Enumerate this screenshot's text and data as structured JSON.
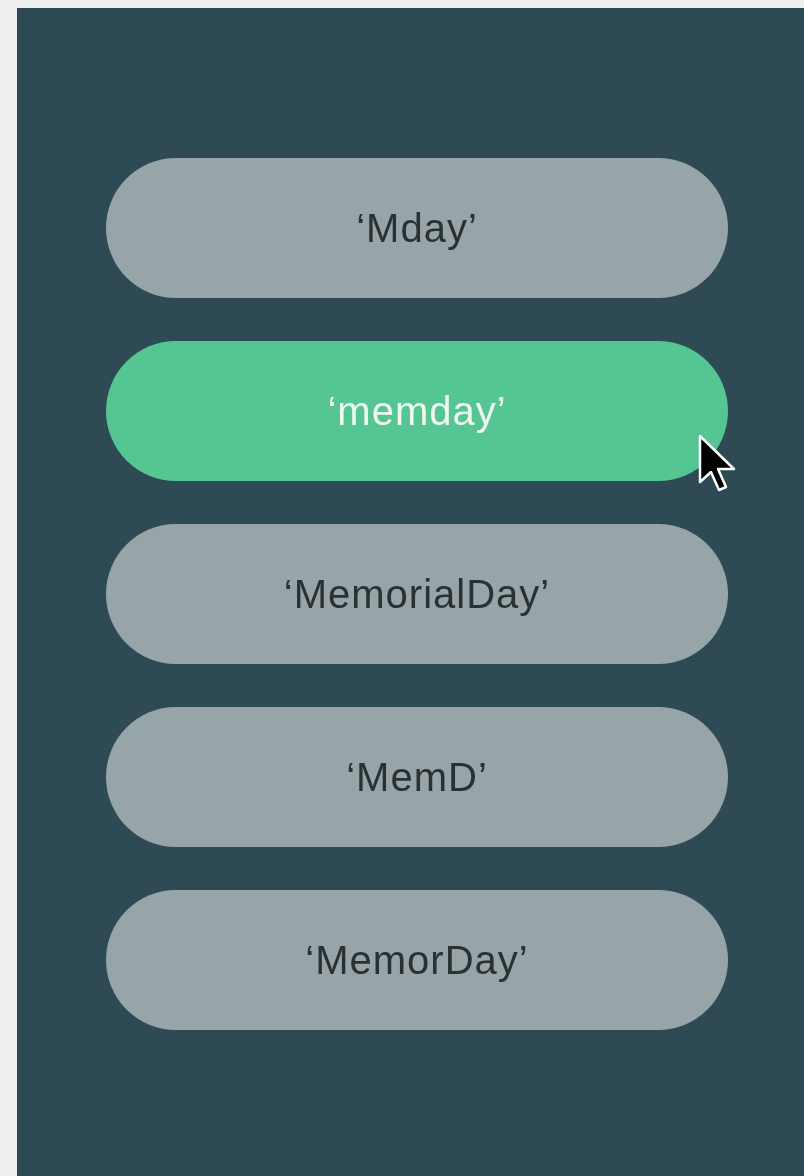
{
  "options": [
    {
      "label": "‘Mday’",
      "selected": false
    },
    {
      "label": "‘memday’",
      "selected": true
    },
    {
      "label": "‘MemorialDay’",
      "selected": false
    },
    {
      "label": "‘MemD’",
      "selected": false
    },
    {
      "label": "‘MemorDay’",
      "selected": false
    }
  ]
}
